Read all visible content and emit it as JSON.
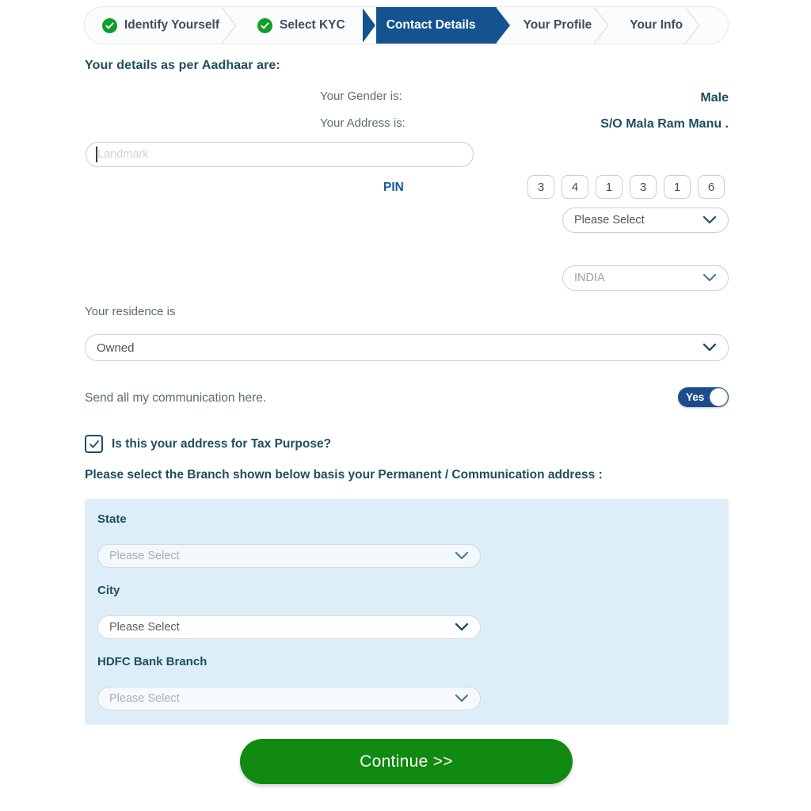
{
  "stepper": {
    "steps": [
      {
        "label": "Identify Yourself",
        "state": "complete"
      },
      {
        "label": "Select KYC",
        "state": "complete"
      },
      {
        "label": "Contact Details",
        "state": "active"
      },
      {
        "label": "Your Profile",
        "state": "pending"
      },
      {
        "label": "Your Info",
        "state": "pending"
      }
    ]
  },
  "details": {
    "heading": "Your details as per Aadhaar are:",
    "gender_label": "Your Gender is:",
    "gender_value": "Male",
    "address_label": "Your Address is:",
    "address_value": "S/O Mala Ram Manu ."
  },
  "landmark": {
    "placeholder": "Landmark",
    "value": ""
  },
  "pin": {
    "label": "PIN",
    "digits": [
      "3",
      "4",
      "1",
      "3",
      "1",
      "6"
    ]
  },
  "selects": {
    "state_top": "Please Select",
    "country": "INDIA"
  },
  "residence": {
    "label": "Your residence is",
    "value": "Owned"
  },
  "communication": {
    "label": "Send all my communication here.",
    "toggle_label": "Yes"
  },
  "tax": {
    "label": "Is this your address for Tax Purpose?",
    "checked": true
  },
  "branch": {
    "heading": "Please select the Branch shown below basis your Permanent / Communication address :",
    "state_label": "State",
    "state_value": "Please Select",
    "city_label": "City",
    "city_value": "Please Select",
    "branch_label": "HDFC Bank Branch",
    "branch_value": "Please Select"
  },
  "actions": {
    "continue_label": "Continue >>"
  },
  "colors": {
    "active_step": "#14538f",
    "check_green": "#109e27",
    "panel_blue": "#ddeef8",
    "continue_green": "#108a10",
    "toggle_blue": "#1b4d8c",
    "heading_teal": "#1f4e5f"
  }
}
